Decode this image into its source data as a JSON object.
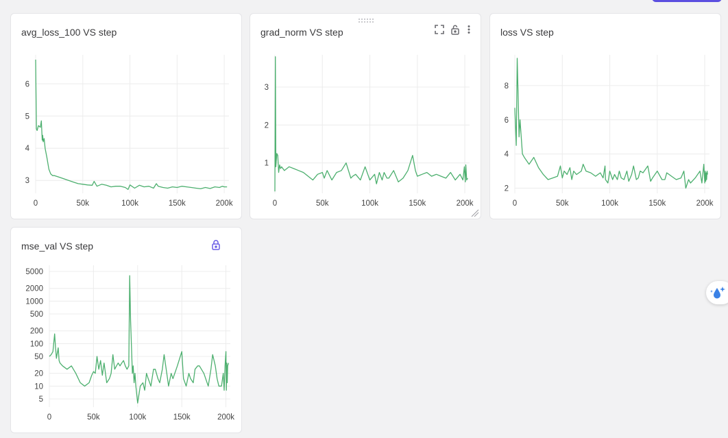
{
  "colors": {
    "series": "#4caf6e",
    "accent": "#5b4fe0",
    "icon": "#6b6b70",
    "lock_active": "#6a5ce6"
  },
  "panels": [
    {
      "title": "avg_loss_100 VS step",
      "icons": []
    },
    {
      "title": "grad_norm VS step",
      "icons": [
        "fullscreen-icon",
        "lock-open-icon",
        "more-vertical-icon"
      ]
    },
    {
      "title": "loss VS step",
      "icons": []
    },
    {
      "title": "mse_val VS step",
      "icons": [
        "lock-icon"
      ]
    }
  ],
  "chart_data": [
    {
      "type": "line",
      "title": "avg_loss_100 VS step",
      "xlabel": "",
      "ylabel": "",
      "xlim": [
        0,
        205000
      ],
      "ylim": [
        2.6,
        6.9
      ],
      "yscale": "linear",
      "x_ticks": [
        0,
        50000,
        100000,
        150000,
        200000
      ],
      "x_tick_labels": [
        "0",
        "50k",
        "100k",
        "150k",
        "200k"
      ],
      "y_ticks": [
        3,
        4,
        5,
        6
      ],
      "y_tick_labels": [
        "3",
        "4",
        "5",
        "6"
      ],
      "grid": true,
      "series": [
        {
          "x": [
            0,
            800,
            1500,
            3000,
            5000,
            6000,
            7000,
            7500,
            8000,
            9000,
            10000,
            12000,
            14000,
            16000,
            18000,
            20000,
            25000,
            30000,
            35000,
            40000,
            45000,
            50000,
            55000,
            60000,
            62000,
            65000,
            70000,
            75000,
            80000,
            85000,
            90000,
            95000,
            98000,
            100000,
            105000,
            110000,
            115000,
            120000,
            125000,
            128000,
            130000,
            135000,
            140000,
            145000,
            150000,
            155000,
            160000,
            165000,
            170000,
            175000,
            180000,
            185000,
            190000,
            195000,
            198000,
            200000,
            203000
          ],
          "y": [
            6.75,
            4.6,
            4.55,
            4.7,
            4.65,
            4.85,
            4.25,
            4.4,
            4.2,
            4.3,
            4.0,
            3.7,
            3.35,
            3.2,
            3.15,
            3.15,
            3.1,
            3.05,
            3.0,
            2.95,
            2.9,
            2.88,
            2.86,
            2.85,
            2.97,
            2.82,
            2.88,
            2.85,
            2.8,
            2.82,
            2.82,
            2.78,
            2.72,
            2.86,
            2.76,
            2.85,
            2.8,
            2.82,
            2.76,
            2.9,
            2.82,
            2.78,
            2.76,
            2.8,
            2.78,
            2.82,
            2.8,
            2.78,
            2.76,
            2.74,
            2.78,
            2.75,
            2.8,
            2.78,
            2.82,
            2.8,
            2.8
          ]
        }
      ]
    },
    {
      "type": "line",
      "title": "grad_norm VS step",
      "xlabel": "",
      "ylabel": "",
      "xlim": [
        0,
        205000
      ],
      "ylim": [
        0.2,
        3.85
      ],
      "yscale": "linear",
      "x_ticks": [
        0,
        50000,
        100000,
        150000,
        200000
      ],
      "x_tick_labels": [
        "0",
        "50k",
        "100k",
        "150k",
        "200k"
      ],
      "y_ticks": [
        1,
        2,
        3
      ],
      "y_tick_labels": [
        "1",
        "2",
        "3"
      ],
      "grid": true,
      "series": [
        {
          "x": [
            0,
            500,
            1000,
            2000,
            3000,
            4000,
            5000,
            6000,
            7000,
            10000,
            15000,
            20000,
            25000,
            30000,
            35000,
            40000,
            45000,
            50000,
            52000,
            55000,
            60000,
            65000,
            70000,
            75000,
            80000,
            82000,
            85000,
            90000,
            95000,
            100000,
            105000,
            107000,
            110000,
            113000,
            115000,
            118000,
            120000,
            125000,
            130000,
            135000,
            140000,
            145000,
            148000,
            150000,
            155000,
            160000,
            165000,
            170000,
            175000,
            180000,
            185000,
            190000,
            195000,
            198000,
            199500,
            200500,
            201000,
            202000,
            203000
          ],
          "y": [
            0.25,
            3.8,
            0.9,
            1.25,
            1.2,
            0.75,
            0.95,
            0.85,
            0.9,
            0.8,
            0.9,
            0.85,
            0.8,
            0.75,
            0.65,
            0.55,
            0.7,
            0.75,
            0.6,
            0.8,
            0.55,
            0.75,
            0.8,
            1.0,
            0.6,
            0.65,
            0.7,
            0.55,
            0.9,
            0.55,
            0.7,
            0.45,
            0.75,
            0.55,
            0.75,
            0.6,
            0.6,
            0.8,
            0.5,
            0.6,
            0.8,
            1.2,
            0.8,
            0.65,
            0.7,
            0.75,
            0.65,
            0.7,
            0.65,
            0.6,
            0.75,
            0.55,
            0.7,
            0.55,
            0.9,
            0.5,
            0.95,
            0.55,
            0.6
          ]
        }
      ]
    },
    {
      "type": "line",
      "title": "loss VS step",
      "xlabel": "",
      "ylabel": "",
      "xlim": [
        0,
        205000
      ],
      "ylim": [
        1.7,
        9.8
      ],
      "yscale": "linear",
      "x_ticks": [
        0,
        50000,
        100000,
        150000,
        200000
      ],
      "x_tick_labels": [
        "0",
        "50k",
        "100k",
        "150k",
        "200k"
      ],
      "y_ticks": [
        2,
        4,
        6,
        8
      ],
      "y_tick_labels": [
        "2",
        "4",
        "6",
        "8"
      ],
      "grid": true,
      "series": [
        {
          "x": [
            0,
            1500,
            2500,
            3500,
            4500,
            5500,
            6500,
            8000,
            10000,
            15000,
            20000,
            25000,
            30000,
            35000,
            40000,
            45000,
            48000,
            50000,
            52000,
            55000,
            58000,
            60000,
            62000,
            65000,
            70000,
            72000,
            75000,
            80000,
            85000,
            90000,
            93000,
            95000,
            95500,
            98000,
            100000,
            103000,
            105000,
            108000,
            110000,
            112000,
            115000,
            118000,
            120000,
            123000,
            125000,
            128000,
            130000,
            132000,
            135000,
            140000,
            143000,
            145000,
            150000,
            155000,
            158000,
            160000,
            165000,
            170000,
            175000,
            178000,
            180000,
            183000,
            185000,
            190000,
            195000,
            197000,
            199000,
            200000,
            200500,
            201000,
            201500,
            202000,
            202500,
            203000
          ],
          "y": [
            6.7,
            4.5,
            9.6,
            7.5,
            5.0,
            6.0,
            5.2,
            4.0,
            3.8,
            3.4,
            3.8,
            3.2,
            2.8,
            2.5,
            2.6,
            2.7,
            3.3,
            2.6,
            3.0,
            2.8,
            3.2,
            2.5,
            3.0,
            2.8,
            3.0,
            3.4,
            3.0,
            2.9,
            2.7,
            2.9,
            2.6,
            3.3,
            2.5,
            2.3,
            3.0,
            2.5,
            2.8,
            2.5,
            3.0,
            2.6,
            2.5,
            3.0,
            2.4,
            2.8,
            3.3,
            2.5,
            2.6,
            3.0,
            2.9,
            3.3,
            2.4,
            2.6,
            3.0,
            2.5,
            2.5,
            2.9,
            2.7,
            2.5,
            2.6,
            3.0,
            2.0,
            2.5,
            2.3,
            2.6,
            3.0,
            2.3,
            3.4,
            2.3,
            3.0,
            2.4,
            2.9,
            2.5,
            3.0,
            2.8
          ]
        }
      ]
    },
    {
      "type": "line",
      "title": "mse_val VS step",
      "xlabel": "",
      "ylabel": "",
      "xlim": [
        0,
        205000
      ],
      "ylim": [
        3.2,
        7000
      ],
      "yscale": "log",
      "x_ticks": [
        0,
        50000,
        100000,
        150000,
        200000
      ],
      "x_tick_labels": [
        "0",
        "50k",
        "100k",
        "150k",
        "200k"
      ],
      "y_ticks": [
        5,
        10,
        20,
        50,
        100,
        200,
        500,
        1000,
        2000,
        5000
      ],
      "y_tick_labels": [
        "5",
        "10",
        "20",
        "50",
        "100",
        "200",
        "500",
        "1000",
        "2000",
        "5000"
      ],
      "grid": true,
      "series": [
        {
          "x": [
            0,
            2000,
            4000,
            6000,
            7000,
            8000,
            9000,
            10000,
            11000,
            12000,
            15000,
            20000,
            25000,
            30000,
            35000,
            40000,
            45000,
            48000,
            50000,
            52000,
            54000,
            56000,
            58000,
            60000,
            62000,
            65000,
            68000,
            70000,
            72000,
            74000,
            76000,
            78000,
            80000,
            82000,
            84000,
            86000,
            88000,
            90000,
            91000,
            92000,
            94000,
            95000,
            96000,
            97000,
            98000,
            100000,
            103000,
            106000,
            108000,
            110000,
            112000,
            115000,
            118000,
            120000,
            123000,
            125000,
            128000,
            130000,
            133000,
            135000,
            138000,
            140000,
            145000,
            150000,
            152000,
            155000,
            158000,
            160000,
            163000,
            165000,
            168000,
            170000,
            175000,
            180000,
            183000,
            185000,
            188000,
            190000,
            192000,
            195000,
            197000,
            198000,
            199000,
            200000,
            200500,
            201000,
            201500,
            202000,
            203000
          ],
          "y": [
            50,
            55,
            65,
            170,
            80,
            45,
            60,
            80,
            40,
            35,
            30,
            25,
            30,
            20,
            12,
            10,
            12,
            18,
            22,
            20,
            50,
            25,
            40,
            18,
            35,
            12,
            15,
            20,
            55,
            25,
            30,
            35,
            30,
            35,
            40,
            30,
            25,
            30,
            4000,
            350,
            20,
            30,
            12,
            20,
            10,
            4,
            10,
            12,
            8,
            20,
            15,
            10,
            25,
            25,
            15,
            12,
            25,
            55,
            20,
            10,
            20,
            15,
            30,
            65,
            15,
            10,
            20,
            15,
            12,
            25,
            30,
            30,
            20,
            10,
            25,
            55,
            30,
            15,
            10,
            10,
            20,
            8,
            30,
            65,
            8,
            35,
            12,
            30,
            35
          ]
        }
      ]
    }
  ]
}
